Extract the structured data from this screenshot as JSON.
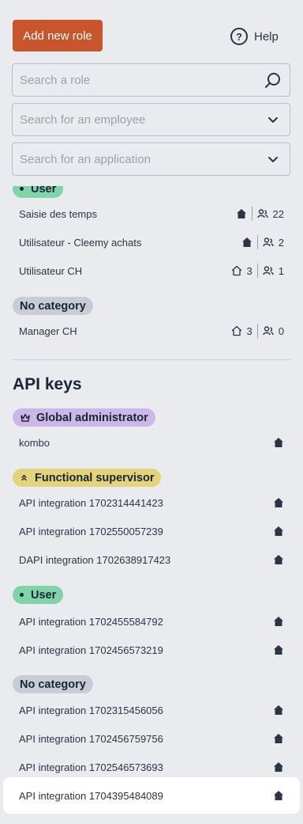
{
  "header": {
    "add_role_label": "Add new role",
    "help_label": "Help"
  },
  "filters": {
    "search_role_placeholder": "Search a role",
    "search_employee_placeholder": "Search for an employee",
    "search_application_placeholder": "Search for an application"
  },
  "roles": {
    "user_category": "User",
    "user_items": [
      {
        "label": "Saisie des temps",
        "users": "22"
      },
      {
        "label": "Utilisateur - Cleemy achats",
        "users": "2"
      },
      {
        "label": "Utilisateur CH",
        "houses": "3",
        "users": "1"
      }
    ],
    "nocat_category": "No category",
    "nocat_items": [
      {
        "label": "Manager CH",
        "houses": "3",
        "users": "0"
      }
    ]
  },
  "api_keys": {
    "title": "API keys",
    "admin_category": "Global administrator",
    "admin_items": [
      {
        "label": "kombo"
      }
    ],
    "func_category": "Functional supervisor",
    "func_items": [
      {
        "label": "API integration 1702314441423"
      },
      {
        "label": "API integration 1702550057239"
      },
      {
        "label": "DAPI integration 1702638917423"
      }
    ],
    "user_category": "User",
    "user_items": [
      {
        "label": "API integration 1702455584792"
      },
      {
        "label": "API integration 1702456573219"
      }
    ],
    "nocat_category": "No category",
    "nocat_items": [
      {
        "label": "API integration 1702315456056"
      },
      {
        "label": "API integration 1702456759756"
      },
      {
        "label": "API integration 1702546573693"
      },
      {
        "label": "API integration 1704395484089"
      }
    ]
  },
  "colors": {
    "primary_button": "#c8552b",
    "pill_user": "#7fd4a8",
    "pill_nocat": "#c7ccd6",
    "pill_admin": "#cbb8e8",
    "pill_func": "#e3d37c"
  }
}
